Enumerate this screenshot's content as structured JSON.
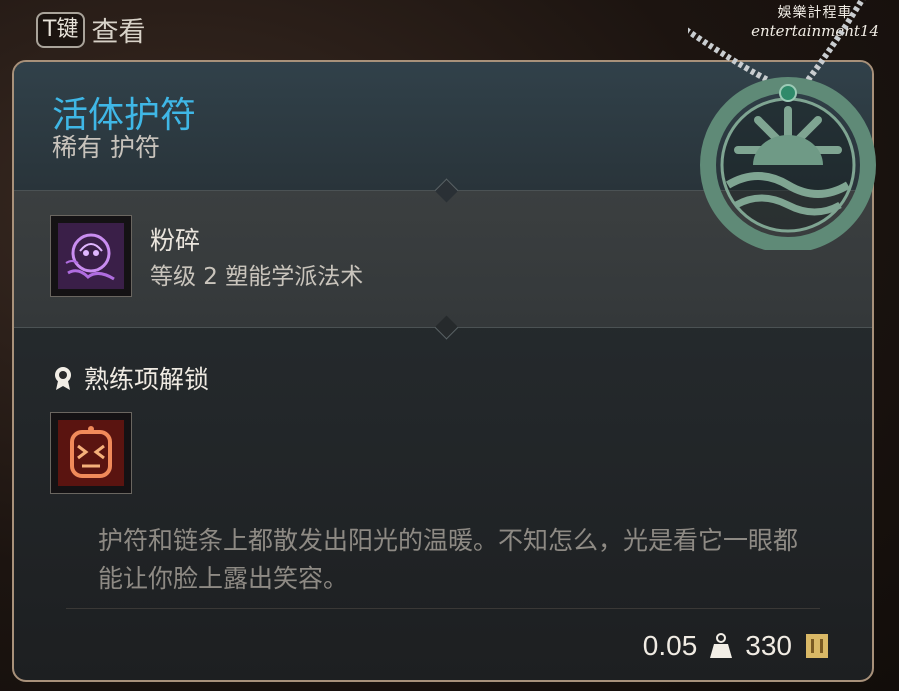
{
  "hint": {
    "key": "T键",
    "label": "查看"
  },
  "watermark": {
    "line1": "娛樂計程車",
    "line2": "entertainment14"
  },
  "item": {
    "name": "活体护符",
    "rarity_type": "稀有 护符",
    "spell": {
      "name": "粉碎",
      "description": "等级 2 塑能学派法术",
      "icon": "shatter-spell-icon"
    },
    "proficiency": {
      "title": "熟练项解锁",
      "icon": "amulet-proficiency-icon"
    },
    "flavor_text": "护符和链条上都散发出阳光的温暖。不知怎么，光是看它一眼都能让你脸上露出笑容。",
    "weight": "0.05",
    "value": "330"
  },
  "colors": {
    "title": "#3fb7e6",
    "panel_border": "#a8917a",
    "amulet_jade": "#5f8a77"
  }
}
